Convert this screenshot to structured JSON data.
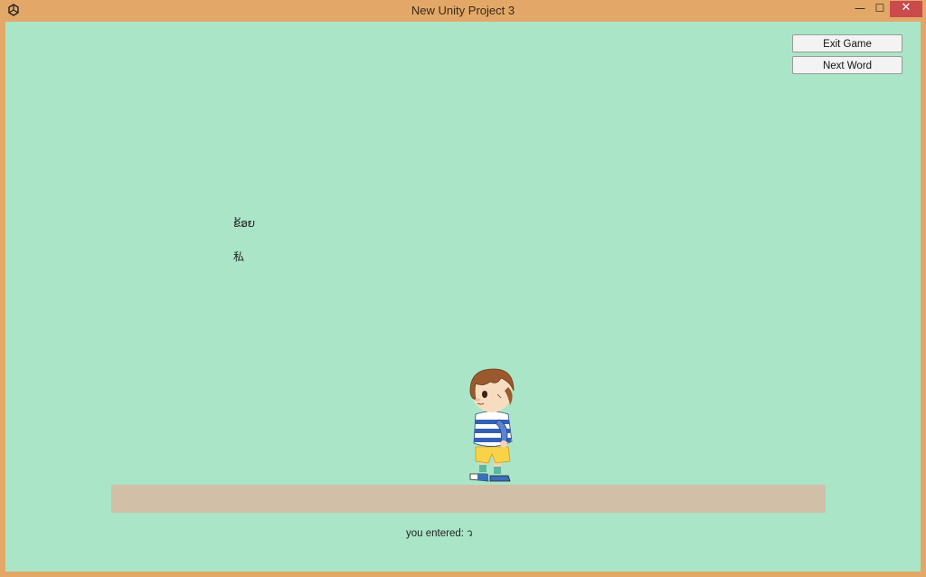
{
  "window": {
    "title": "New Unity Project 3",
    "app_icon": "unity-icon",
    "controls": {
      "minimize": "—",
      "maximize": "☐",
      "close": "✕"
    }
  },
  "ui": {
    "exit_button": "Exit Game",
    "next_word_button": "Next Word"
  },
  "words": {
    "lao": "ຂ້ອຍ",
    "japanese": "私"
  },
  "input": {
    "entered_text": "you entered: ว"
  },
  "colors": {
    "window_frame": "#e3a868",
    "background": "#aae5c7",
    "ground": "#d2bfa8",
    "close_button": "#c94b4b"
  },
  "icons": [
    "unity-icon",
    "minimize-icon",
    "maximize-icon",
    "close-icon"
  ]
}
